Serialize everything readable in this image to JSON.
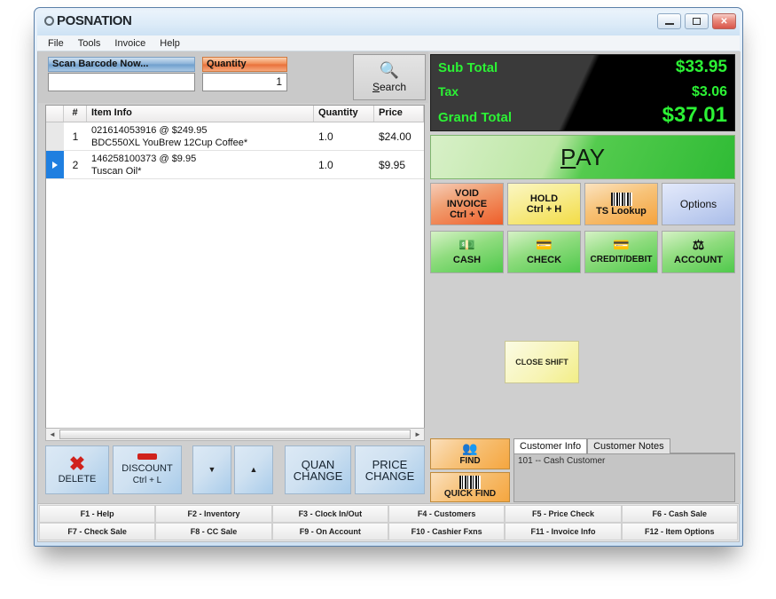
{
  "window": {
    "logo_text": "POSNATION",
    "minimize_label": "minimize",
    "maximize_label": "maximize",
    "close_label": "✕"
  },
  "menu": {
    "items": [
      "File",
      "Tools",
      "Invoice",
      "Help"
    ]
  },
  "toolbar": {
    "scan_label": "Scan Barcode Now...",
    "scan_value": "",
    "quantity_label": "Quantity",
    "quantity_value": "1",
    "search_label": "Search",
    "search_icon": "search-icon",
    "search_glyph": "🔍"
  },
  "grid": {
    "columns": [
      "",
      "#",
      "Item Info",
      "Quantity",
      "Price"
    ],
    "rows": [
      {
        "num": "1",
        "line1": "021614053916 @  $249.95",
        "line2": "BDC550XL YouBrew  12Cup Coffee*",
        "quantity": "1.0",
        "price": "$24.00",
        "selected": false
      },
      {
        "num": "2",
        "line1": "146258100373 @  $9.95",
        "line2": "Tuscan Oil*",
        "quantity": "1.0",
        "price": "$9.95",
        "selected": true
      }
    ],
    "scroll_left_glyph": "◄",
    "scroll_right_glyph": "►"
  },
  "left_buttons": [
    {
      "name": "delete",
      "glyph": "✖",
      "label": "DELETE",
      "sub": ""
    },
    {
      "name": "discount",
      "glyph": "dash",
      "label": "DISCOUNT",
      "sub": "Ctrl + L"
    },
    {
      "name": "scroll-down",
      "glyph": "▼",
      "label": "",
      "sub": ""
    },
    {
      "name": "scroll-up",
      "glyph": "▲",
      "label": "",
      "sub": ""
    },
    {
      "name": "quan-change",
      "glyph": "",
      "label": "QUAN",
      "sub": "CHANGE"
    },
    {
      "name": "price-change",
      "glyph": "",
      "label": "PRICE",
      "sub": "CHANGE"
    }
  ],
  "totals": {
    "subtotal_label": "Sub Total",
    "subtotal_value": "$33.95",
    "tax_label": "Tax",
    "tax_value": "$3.06",
    "grand_label": "Grand Total",
    "grand_value": "$37.01",
    "accent_color": "#2cf235",
    "background_color": "#3a3a3a"
  },
  "pay": {
    "label_pre": "P",
    "label_post": "AY"
  },
  "action_buttons": [
    {
      "name": "void-invoice",
      "line1": "VOID",
      "line2": "INVOICE",
      "line3": "Ctrl + V",
      "color": "#ef5e2a"
    },
    {
      "name": "hold",
      "line1": "HOLD",
      "line2": "Ctrl + H",
      "line3": "",
      "color": "#f3dc46"
    },
    {
      "name": "ts-lookup",
      "line1": "",
      "line2": "TS Lookup",
      "line3": "",
      "color": "#f5a33d",
      "icon": "barcode-icon"
    },
    {
      "name": "options",
      "line1": "",
      "line2": "Options",
      "line3": "",
      "color": "#aabde9"
    }
  ],
  "payment_buttons": [
    {
      "name": "cash",
      "label": "CASH",
      "icon": "cash-icon",
      "glyph": "💵"
    },
    {
      "name": "check",
      "label": "CHECK",
      "icon": "check-icon",
      "glyph": "💳"
    },
    {
      "name": "credit-debit",
      "label": "CREDIT/DEBIT",
      "icon": "credit-card-icon",
      "glyph": "💳"
    },
    {
      "name": "account",
      "label": "ACCOUNT",
      "icon": "scales-icon",
      "glyph": "⚖"
    }
  ],
  "close_shift": {
    "label": "CLOSE SHIFT"
  },
  "customer": {
    "find_label": "FIND",
    "find_glyph": "👥",
    "quick_find_label": "QUICK FIND",
    "quick_find_icon": "barcode-icon",
    "tabs": [
      {
        "label": "Customer Info",
        "active": true
      },
      {
        "label": "Customer Notes",
        "active": false
      }
    ],
    "info_text": "101 -- Cash Customer"
  },
  "function_keys": {
    "row1": [
      "F1 - Help",
      "F2 - Inventory",
      "F3 - Clock In/Out",
      "F4 - Customers",
      "F5 - Price Check",
      "F6 - Cash Sale"
    ],
    "row2": [
      "F7 - Check Sale",
      "F8 - CC Sale",
      "F9 - On Account",
      "F10 - Cashier Fxns",
      "F11 - Invoice Info",
      "F12 - Item Options"
    ]
  }
}
